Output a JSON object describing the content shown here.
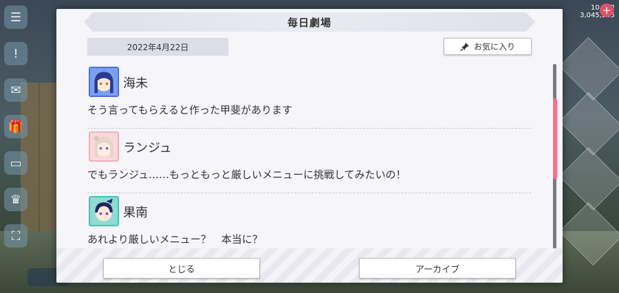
{
  "dialog": {
    "title": "毎日劇場",
    "date": "2022年4月22日",
    "favorite_label": "お気に入り",
    "close_label": "とじる",
    "archive_label": "アーカイブ"
  },
  "messages": [
    {
      "speaker": "海未",
      "text": "そう言ってもらえると作った甲斐があります",
      "avatar_color": "#4a6fd8"
    },
    {
      "speaker": "ランジュ",
      "text": "でもランジュ……もっともっと厳しいメニューに挑戦してみたいの！",
      "avatar_color": "#f0b0b8"
    },
    {
      "speaker": "果南",
      "text": "あれより厳しいメニュー？　本当に？",
      "avatar_color": "#49c0b6"
    }
  ],
  "status": {
    "line1": "10,762",
    "line2": "3,045,565"
  },
  "colors": {
    "scroll_thumb": "#ff6f87",
    "accent_plus": "#e0506a"
  }
}
